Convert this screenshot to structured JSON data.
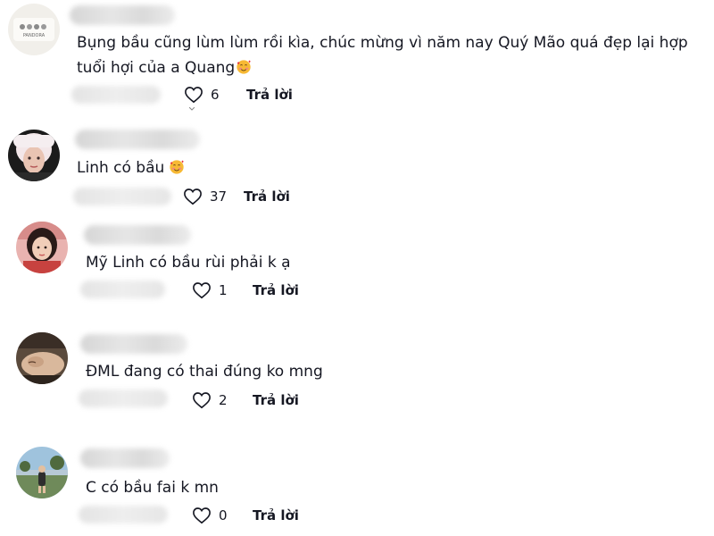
{
  "comments": [
    {
      "avatar_icon": "pandora-jewelry-avatar-icon",
      "avatar_text": "PANDORA",
      "text": "Bụng bầu cũng lùm lùm rồi kìa, chúc mừng vì năm nay Quý Mão quá đẹp lại hợp\ntuổi hợi của a Quang",
      "emoji": "smiling-face-with-hearts-icon",
      "likes": "6",
      "reply": "Trả lời"
    },
    {
      "avatar_icon": "woman-avatar-icon",
      "text": "Linh có bầu",
      "emoji": "smiling-face-with-hearts-icon",
      "likes": "37",
      "reply": "Trả lời"
    },
    {
      "avatar_icon": "girl-avatar-icon",
      "text": "Mỹ Linh có bầu rùi phải k ạ",
      "likes": "1",
      "reply": "Trả lời"
    },
    {
      "avatar_icon": "sleeping-person-avatar-icon",
      "text": "ĐML đang có thai đúng ko mng",
      "likes": "2",
      "reply": "Trả lời"
    },
    {
      "avatar_icon": "outdoor-person-avatar-icon",
      "text": "C có bầu fai k mn",
      "likes": "0",
      "reply": "Trả lời"
    }
  ],
  "colors": {
    "text": "#161823",
    "background": "#ffffff",
    "heart_outline": "#161823"
  }
}
